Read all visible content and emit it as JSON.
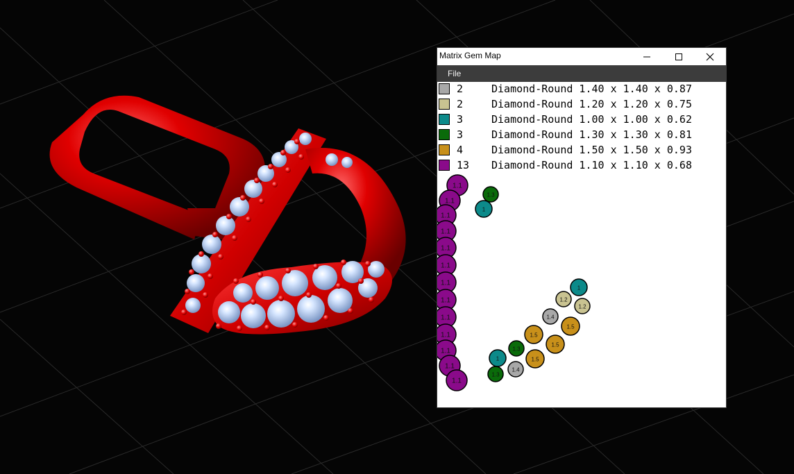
{
  "window": {
    "title": "Matrix Gem Map",
    "minimize_label": "minimize",
    "maximize_label": "maximize",
    "close_label": "close"
  },
  "menu": {
    "file": "File"
  },
  "legend": [
    {
      "count": "2",
      "description": "Diamond-Round 1.40 x 1.40 x 0.87",
      "color": "#a8a8a8"
    },
    {
      "count": "2",
      "description": "Diamond-Round 1.20 x 1.20 x 0.75",
      "color": "#c9c391"
    },
    {
      "count": "3",
      "description": "Diamond-Round 1.00 x 1.00 x 0.62",
      "color": "#0c8a8a"
    },
    {
      "count": "3",
      "description": "Diamond-Round 1.30 x 1.30 x 0.81",
      "color": "#0a6b0a"
    },
    {
      "count": "4",
      "description": "Diamond-Round 1.50 x 1.50 x 0.93",
      "color": "#c8901a"
    },
    {
      "count": "13",
      "description": "Diamond-Round 1.10 x 1.10 x 0.68",
      "color": "#8a0a8a"
    }
  ],
  "gem_map": {
    "gems": [
      {
        "label": "1.1",
        "type": 5
      },
      {
        "label": "1.1",
        "type": 5
      },
      {
        "label": "1.1",
        "type": 5
      },
      {
        "label": "1.1",
        "type": 5
      },
      {
        "label": "1.1",
        "type": 5
      },
      {
        "label": "1.1",
        "type": 5
      },
      {
        "label": "1.1",
        "type": 5
      },
      {
        "label": "1.1",
        "type": 5
      },
      {
        "label": "1.1",
        "type": 5
      },
      {
        "label": "1.1",
        "type": 5
      },
      {
        "label": "1.1",
        "type": 5
      },
      {
        "label": "1.1",
        "type": 5
      },
      {
        "label": "1.1",
        "type": 5
      },
      {
        "label": "1.3",
        "type": 3
      },
      {
        "label": "1",
        "type": 2
      },
      {
        "label": "1",
        "type": 2
      },
      {
        "label": "1.2",
        "type": 1
      },
      {
        "label": "1.2",
        "type": 1
      },
      {
        "label": "1.4",
        "type": 0
      },
      {
        "label": "1.5",
        "type": 4
      },
      {
        "label": "1.5",
        "type": 4
      },
      {
        "label": "1.5",
        "type": 4
      },
      {
        "label": "1.5",
        "type": 4
      },
      {
        "label": "1.3",
        "type": 3
      },
      {
        "label": "1",
        "type": 2
      },
      {
        "label": "1.4",
        "type": 0
      },
      {
        "label": "1.3",
        "type": 3
      }
    ]
  }
}
